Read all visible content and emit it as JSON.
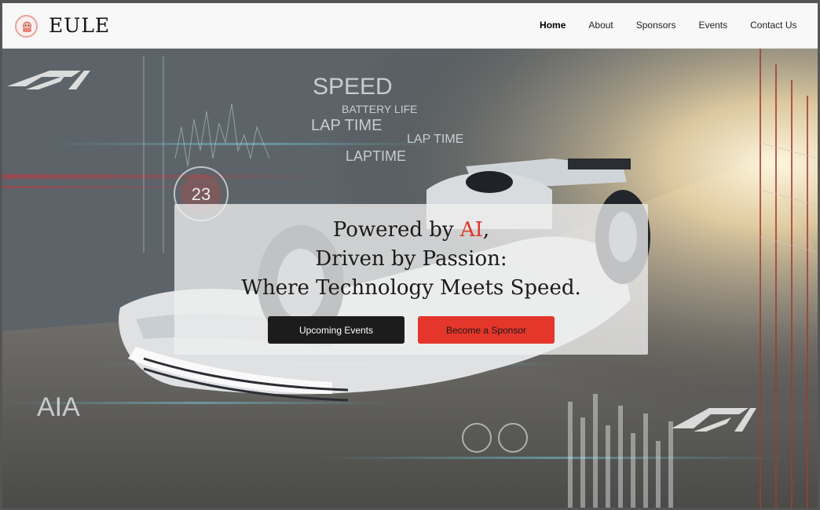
{
  "header": {
    "brand": "EULE",
    "logo_icon": "mascot-logo-icon",
    "nav": [
      {
        "label": "Home",
        "active": true
      },
      {
        "label": "About",
        "active": false
      },
      {
        "label": "Sponsors",
        "active": false
      },
      {
        "label": "Events",
        "active": false
      },
      {
        "label": "Contact Us",
        "active": false
      }
    ]
  },
  "hero": {
    "background_image": "f1-race-car-ai-telemetry",
    "headline": {
      "line1_prefix": "Powered by ",
      "line1_accent": "AI",
      "line1_suffix": ",",
      "line2": "Driven by Passion:",
      "line3": "Where Technology Meets Speed."
    },
    "buttons": {
      "primary": "Upcoming Events",
      "secondary": "Become a Sponsor"
    },
    "overlay_text": {
      "speed": "SPEED",
      "battery": "BATTERY LIFE",
      "lap1": "LAP TIME",
      "lap2": "LAP TIME",
      "lap3": "LAPTIME",
      "gauge": "23",
      "ai": "AIA"
    }
  },
  "colors": {
    "accent": "#e1352a",
    "dark_button": "#1c1c1c",
    "header_bg": "#f8f8f8"
  }
}
